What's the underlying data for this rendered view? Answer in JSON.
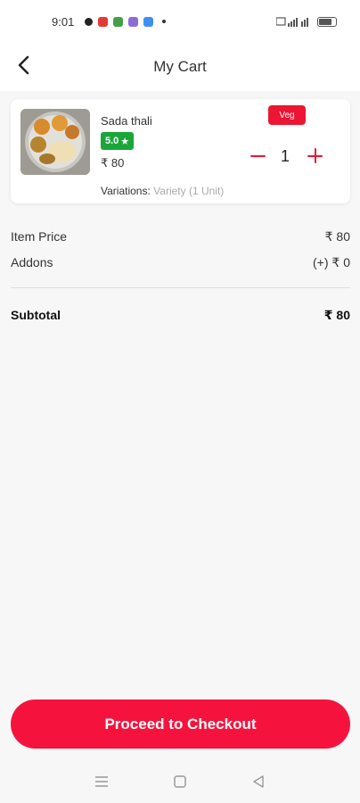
{
  "status_bar": {
    "time": "9:01",
    "battery": "100"
  },
  "header": {
    "title": "My Cart",
    "back_icon": "back-arrow-icon"
  },
  "cart_item": {
    "name": "Sada thali",
    "rating": "5.0",
    "price": "₹ 80",
    "tag": "Veg",
    "quantity": "1",
    "variations_label": "Variations:",
    "variations_value": "Variety (1 Unit)"
  },
  "summary": {
    "item_price_label": "Item Price",
    "item_price_value": "₹ 80",
    "addons_label": "Addons",
    "addons_value": "(+) ₹ 0",
    "subtotal_label": "Subtotal",
    "subtotal_value": "₹ 80"
  },
  "checkout": {
    "label": "Proceed to Checkout"
  },
  "colors": {
    "accent": "#f5133d",
    "rating": "#1aa63a"
  }
}
